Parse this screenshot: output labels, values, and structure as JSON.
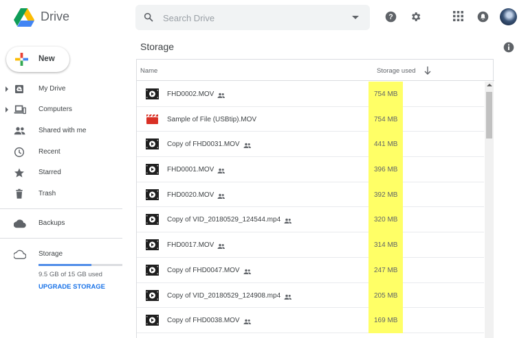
{
  "header": {
    "brand": "Drive",
    "search_placeholder": "Search Drive",
    "icons": [
      "help-icon",
      "settings-icon",
      "apps-icon",
      "notifications-icon",
      "avatar"
    ]
  },
  "sidebar": {
    "new_label": "New",
    "items": [
      {
        "label": "My Drive",
        "icon": "my-drive-icon",
        "expandable": true
      },
      {
        "label": "Computers",
        "icon": "computers-icon",
        "expandable": true
      },
      {
        "label": "Shared with me",
        "icon": "shared-with-me-icon"
      },
      {
        "label": "Recent",
        "icon": "recent-icon"
      },
      {
        "label": "Starred",
        "icon": "starred-icon"
      },
      {
        "label": "Trash",
        "icon": "trash-icon"
      },
      {
        "label": "Backups",
        "icon": "backups-icon"
      },
      {
        "label": "Storage",
        "icon": "storage-icon"
      }
    ],
    "storage_usage": "9.5 GB of 15 GB used",
    "storage_fraction": 0.63,
    "upgrade_label": "UPGRADE STORAGE"
  },
  "main": {
    "title": "Storage",
    "columns": {
      "name": "Name",
      "storage": "Storage used"
    },
    "files": [
      {
        "name": "FHD0002.MOV",
        "size": "754 MB",
        "shared": true,
        "type": "video"
      },
      {
        "name": "Sample of File (USBtip).MOV",
        "size": "754 MB",
        "shared": false,
        "type": "clapper"
      },
      {
        "name": "Copy of FHD0031.MOV",
        "size": "441 MB",
        "shared": true,
        "type": "video"
      },
      {
        "name": "FHD0001.MOV",
        "size": "396 MB",
        "shared": true,
        "type": "video"
      },
      {
        "name": "FHD0020.MOV",
        "size": "392 MB",
        "shared": true,
        "type": "video"
      },
      {
        "name": "Copy of VID_20180529_124544.mp4",
        "size": "320 MB",
        "shared": true,
        "type": "video"
      },
      {
        "name": "FHD0017.MOV",
        "size": "314 MB",
        "shared": true,
        "type": "video"
      },
      {
        "name": "Copy of FHD0047.MOV",
        "size": "247 MB",
        "shared": true,
        "type": "video"
      },
      {
        "name": "Copy of VID_20180529_124908.mp4",
        "size": "205 MB",
        "shared": true,
        "type": "video"
      },
      {
        "name": "Copy of FHD0038.MOV",
        "size": "169 MB",
        "shared": true,
        "type": "video"
      }
    ]
  },
  "colors": {
    "highlight": "#ffff66",
    "accent_blue": "#1a73e8",
    "storage_bar": "#4c8ae8",
    "clapper_red": "#d93025"
  }
}
